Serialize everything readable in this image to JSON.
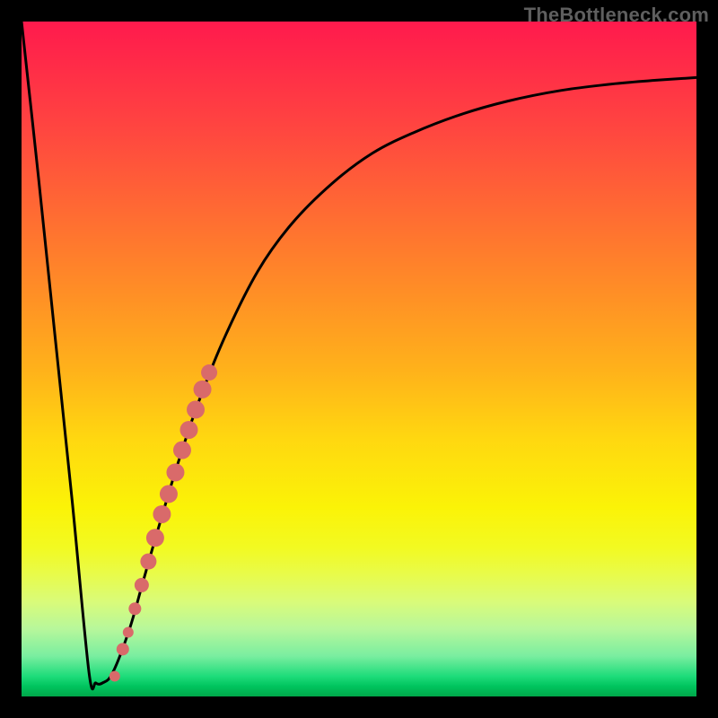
{
  "watermark": "TheBottleneck.com",
  "colors": {
    "frame": "#000000",
    "curve": "#000000",
    "marker_fill": "#d96a6a",
    "marker_stroke": "#9c3a3a"
  },
  "chart_data": {
    "type": "line",
    "title": "",
    "xlabel": "",
    "ylabel": "",
    "xlim": [
      0,
      1
    ],
    "ylim": [
      0,
      1
    ],
    "series": [
      {
        "name": "bottleneck-curve",
        "x": [
          0.0,
          0.025,
          0.05,
          0.075,
          0.1,
          0.11,
          0.12,
          0.135,
          0.16,
          0.18,
          0.2,
          0.23,
          0.26,
          0.3,
          0.35,
          0.4,
          0.46,
          0.52,
          0.58,
          0.65,
          0.72,
          0.8,
          0.88,
          0.94,
          1.0
        ],
        "y": [
          1.0,
          0.77,
          0.53,
          0.29,
          0.035,
          0.02,
          0.02,
          0.035,
          0.1,
          0.17,
          0.24,
          0.34,
          0.43,
          0.53,
          0.63,
          0.7,
          0.76,
          0.805,
          0.835,
          0.862,
          0.882,
          0.898,
          0.908,
          0.913,
          0.917
        ]
      }
    ],
    "markers": {
      "name": "highlight-points",
      "x": [
        0.138,
        0.15,
        0.158,
        0.168,
        0.178,
        0.188,
        0.198,
        0.208,
        0.218,
        0.228,
        0.238,
        0.248,
        0.258,
        0.268,
        0.278
      ],
      "y": [
        0.03,
        0.07,
        0.095,
        0.13,
        0.165,
        0.2,
        0.235,
        0.27,
        0.3,
        0.332,
        0.365,
        0.395,
        0.425,
        0.455,
        0.48
      ],
      "r": [
        6,
        7,
        6,
        7,
        8,
        9,
        10,
        10,
        10,
        10,
        10,
        10,
        10,
        10,
        9
      ]
    }
  }
}
